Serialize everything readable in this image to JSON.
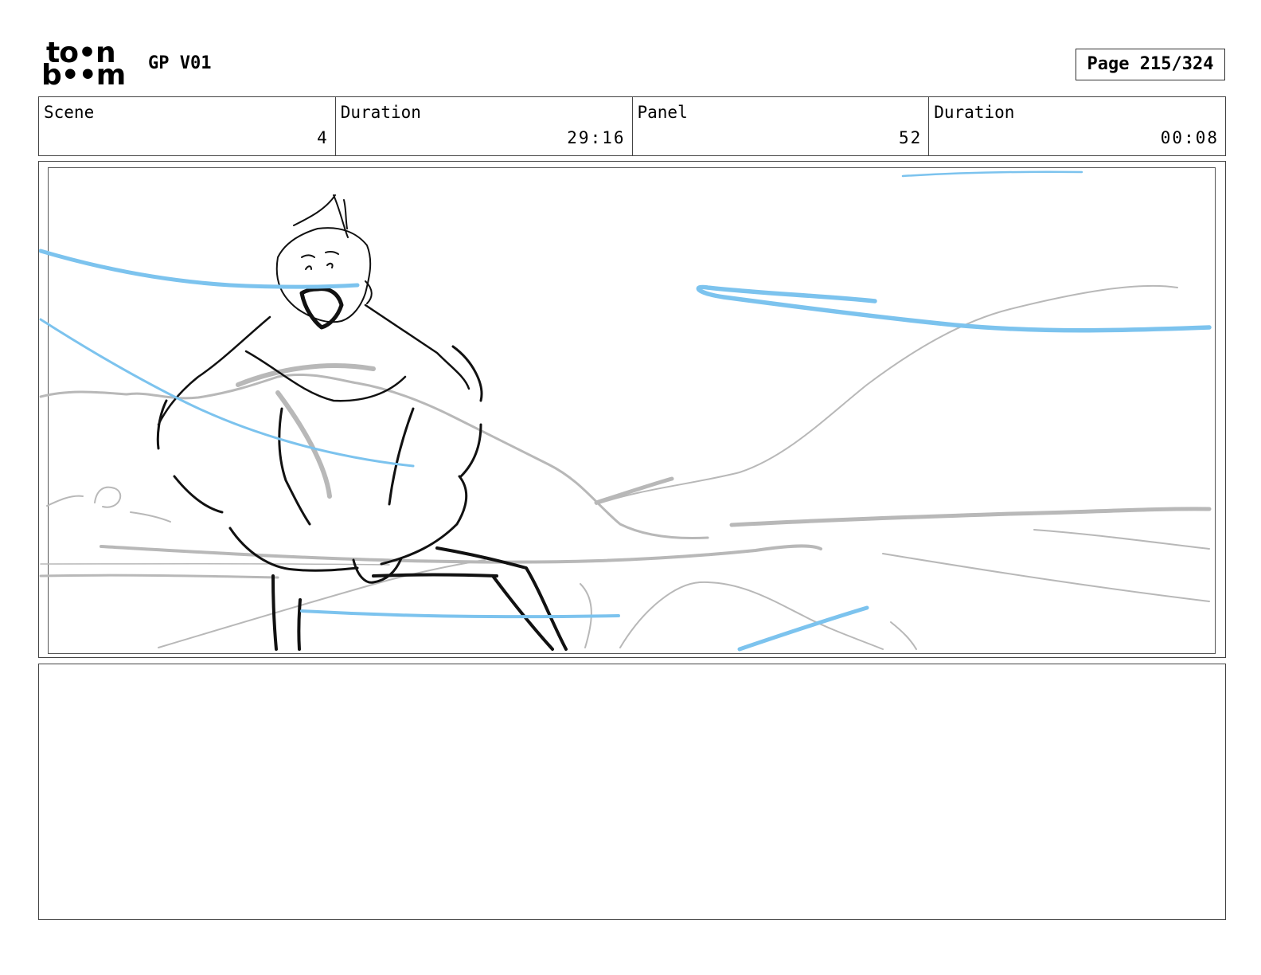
{
  "header": {
    "logo": {
      "line1": "to•n",
      "line2": "b••m"
    },
    "project_title": "GP V01",
    "page_label": "Page 215/324"
  },
  "info": {
    "scene_label": "Scene",
    "scene_value": "4",
    "scene_duration_label": "Duration",
    "scene_duration_value": "29:16",
    "panel_label": "Panel",
    "panel_value": "52",
    "panel_duration_label": "Duration",
    "panel_duration_value": "00:08"
  },
  "notes": {
    "text": ""
  },
  "colors": {
    "sketch_black": "#111111",
    "sketch_gray": "#b8b8b8",
    "sketch_blue": "#7cc3ee"
  }
}
